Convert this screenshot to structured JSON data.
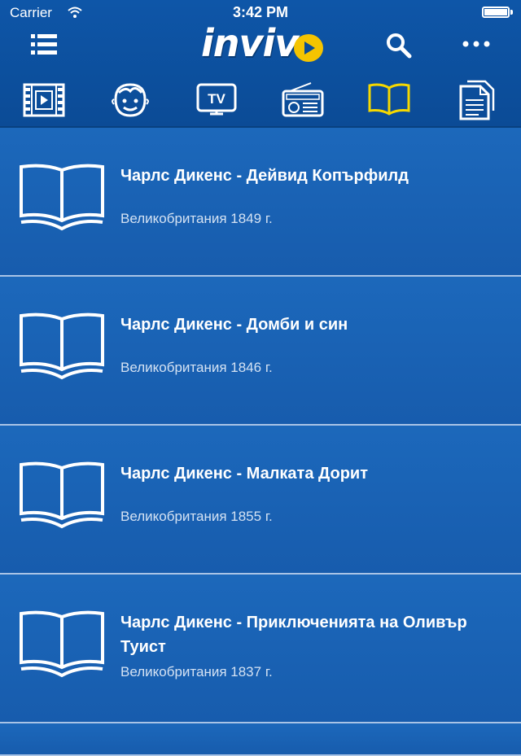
{
  "status_bar": {
    "carrier": "Carrier",
    "time": "3:42 PM"
  },
  "nav": {
    "logo": "invivo",
    "menu_icon": "menu-icon",
    "search_icon": "search-icon",
    "more_icon": "more-icon"
  },
  "categories": [
    {
      "name": "film-icon",
      "active": false
    },
    {
      "name": "kid-face-icon",
      "active": false
    },
    {
      "name": "tv-icon",
      "active": false
    },
    {
      "name": "radio-icon",
      "active": false
    },
    {
      "name": "book-icon",
      "active": true
    },
    {
      "name": "documents-icon",
      "active": false
    }
  ],
  "colors": {
    "active": "#f5d800",
    "background": "#1a63b6",
    "header": "#0b4b96"
  },
  "items": [
    {
      "title": "Чарлс Дикенс - Дейвид Копърфилд",
      "subtitle": "Великобритания 1849 г."
    },
    {
      "title": "Чарлс Дикенс - Домби и син",
      "subtitle": "Великобритания 1846 г."
    },
    {
      "title": "Чарлс Дикенс - Малката Дорит",
      "subtitle": "Великобритания 1855 г."
    },
    {
      "title": "Чарлс Дикенс - Приключенията на Оливър Туист",
      "subtitle": "Великобритания 1837 г."
    }
  ]
}
